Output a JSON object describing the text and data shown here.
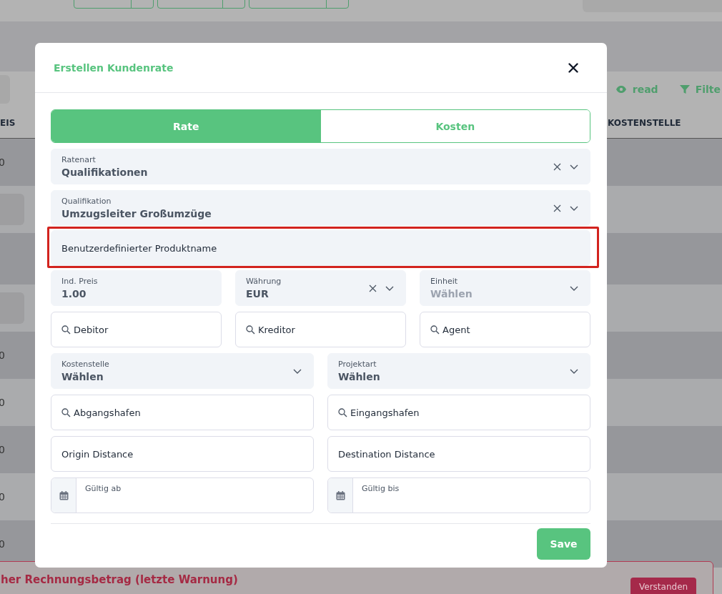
{
  "background": {
    "toolbar": [
      {
        "kind": "view",
        "label": "read"
      },
      {
        "kind": "filter",
        "label": "Filte"
      }
    ],
    "table": {
      "columns": [
        {
          "label": "EIS"
        },
        {
          "label": "KOSTENSTELLE"
        }
      ],
      "rows": [
        {
          "kind": "text",
          "cell": "0"
        },
        {
          "kind": "chip"
        },
        {
          "kind": "tall"
        },
        {
          "kind": "chip"
        },
        {
          "kind": "text",
          "cell": "0"
        },
        {
          "kind": "text",
          "cell": "0"
        },
        {
          "kind": "text",
          "cell": "0"
        },
        {
          "kind": "text",
          "cell": "0"
        },
        {
          "kind": "text",
          "cell": "0"
        }
      ]
    },
    "warning": {
      "title": "her Rechnungsbetrag (letzte Warnung)",
      "button": "Verstanden"
    }
  },
  "dialog": {
    "title": "Erstellen Kundenrate",
    "tabs": [
      {
        "label": "Rate",
        "selected": true
      },
      {
        "label": "Kosten",
        "selected": false
      }
    ],
    "rows": [
      [
        {
          "kind": "select",
          "label": "Ratenart",
          "value": "Qualifikationen",
          "clearable": true
        }
      ],
      [
        {
          "kind": "select",
          "label": "Qualifikation",
          "value": "Umzugsleiter Großumzüge",
          "clearable": true
        }
      ],
      [
        {
          "kind": "text",
          "placeholder": "Benutzerdefinierter Produktname",
          "filled": true,
          "highlighted": true
        }
      ],
      [
        {
          "kind": "input",
          "label": "Ind. Preis",
          "value": "1.00"
        },
        {
          "kind": "select",
          "label": "Währung",
          "value": "EUR",
          "clearable": true
        },
        {
          "kind": "select",
          "label": "Einheit",
          "placeholder": "Wählen",
          "clearable": false
        }
      ],
      [
        {
          "kind": "search",
          "placeholder": "Debitor"
        },
        {
          "kind": "search",
          "placeholder": "Kreditor"
        },
        {
          "kind": "search",
          "placeholder": "Agent"
        }
      ],
      [
        {
          "kind": "select",
          "label": "Kostenstelle",
          "value": "Wählen",
          "clearable": false
        },
        {
          "kind": "select",
          "label": "Projektart",
          "value": "Wählen",
          "clearable": false
        }
      ],
      [
        {
          "kind": "search",
          "placeholder": "Abgangshafen"
        },
        {
          "kind": "search",
          "placeholder": "Eingangshafen"
        }
      ],
      [
        {
          "kind": "text",
          "placeholder": "Origin Distance",
          "filled": false
        },
        {
          "kind": "text",
          "placeholder": "Destination Distance",
          "filled": false
        }
      ],
      [
        {
          "kind": "date",
          "label": "Gültig ab"
        },
        {
          "kind": "date",
          "label": "Gültig bis"
        }
      ]
    ],
    "save": "Save"
  }
}
